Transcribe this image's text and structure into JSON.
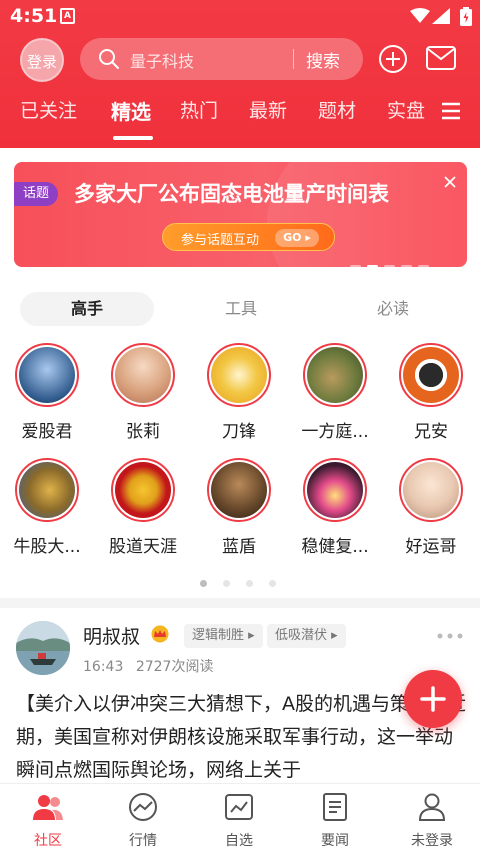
{
  "status_bar": {
    "time": "4:51",
    "a_icon": "A"
  },
  "header": {
    "login_label": "登录",
    "search": {
      "placeholder": "量子科技",
      "button": "搜索"
    },
    "tabs": [
      {
        "label": "已关注",
        "active": false
      },
      {
        "label": "精选",
        "active": true
      },
      {
        "label": "热门",
        "active": false
      },
      {
        "label": "最新",
        "active": false
      },
      {
        "label": "题材",
        "active": false
      },
      {
        "label": "实盘",
        "active": false
      }
    ]
  },
  "banner": {
    "tag": "话题",
    "title": "多家大厂公布固态电池量产时间表",
    "cta_label": "参与话题互动",
    "cta_go": "GO"
  },
  "segments": [
    {
      "label": "高手",
      "active": true
    },
    {
      "label": "工具",
      "active": false
    },
    {
      "label": "必读",
      "active": false
    }
  ],
  "masters": [
    {
      "name": "爱股君",
      "color": "#2f5a8c"
    },
    {
      "name": "张莉",
      "color": "#d9a27e"
    },
    {
      "name": "刀锋",
      "color": "#e8b22a"
    },
    {
      "name": "一方庭...",
      "color": "#6c7a3d"
    },
    {
      "name": "兄安",
      "color": "#e5641e"
    },
    {
      "name": "牛股大...",
      "color": "#8a6a2a"
    },
    {
      "name": "股道天涯",
      "color": "#c2161a"
    },
    {
      "name": "蓝盾",
      "color": "#6a4a2c"
    },
    {
      "name": "稳健复...",
      "color": "#3a1b2e"
    },
    {
      "name": "好运哥",
      "color": "#e9c9b2"
    }
  ],
  "post": {
    "author": "明叔叔",
    "tags": [
      "逻辑制胜",
      "低吸潜伏"
    ],
    "time": "16:43",
    "reads": "2727次阅读",
    "text": "【美介入以伊冲突三大猜想下，A股的机遇与策略】近期，美国宣称对伊朗核设施采取军事行动，这一举动瞬间点燃国际舆论场，网络上关于"
  },
  "bottom_nav": [
    {
      "label": "社区",
      "active": true
    },
    {
      "label": "行情",
      "active": false
    },
    {
      "label": "自选",
      "active": false
    },
    {
      "label": "要闻",
      "active": false
    },
    {
      "label": "未登录",
      "active": false
    }
  ],
  "colors": {
    "brand_red": "#f03a44",
    "tag_purple": "#8e3fc4",
    "cta_orange": "#ff8a24"
  }
}
